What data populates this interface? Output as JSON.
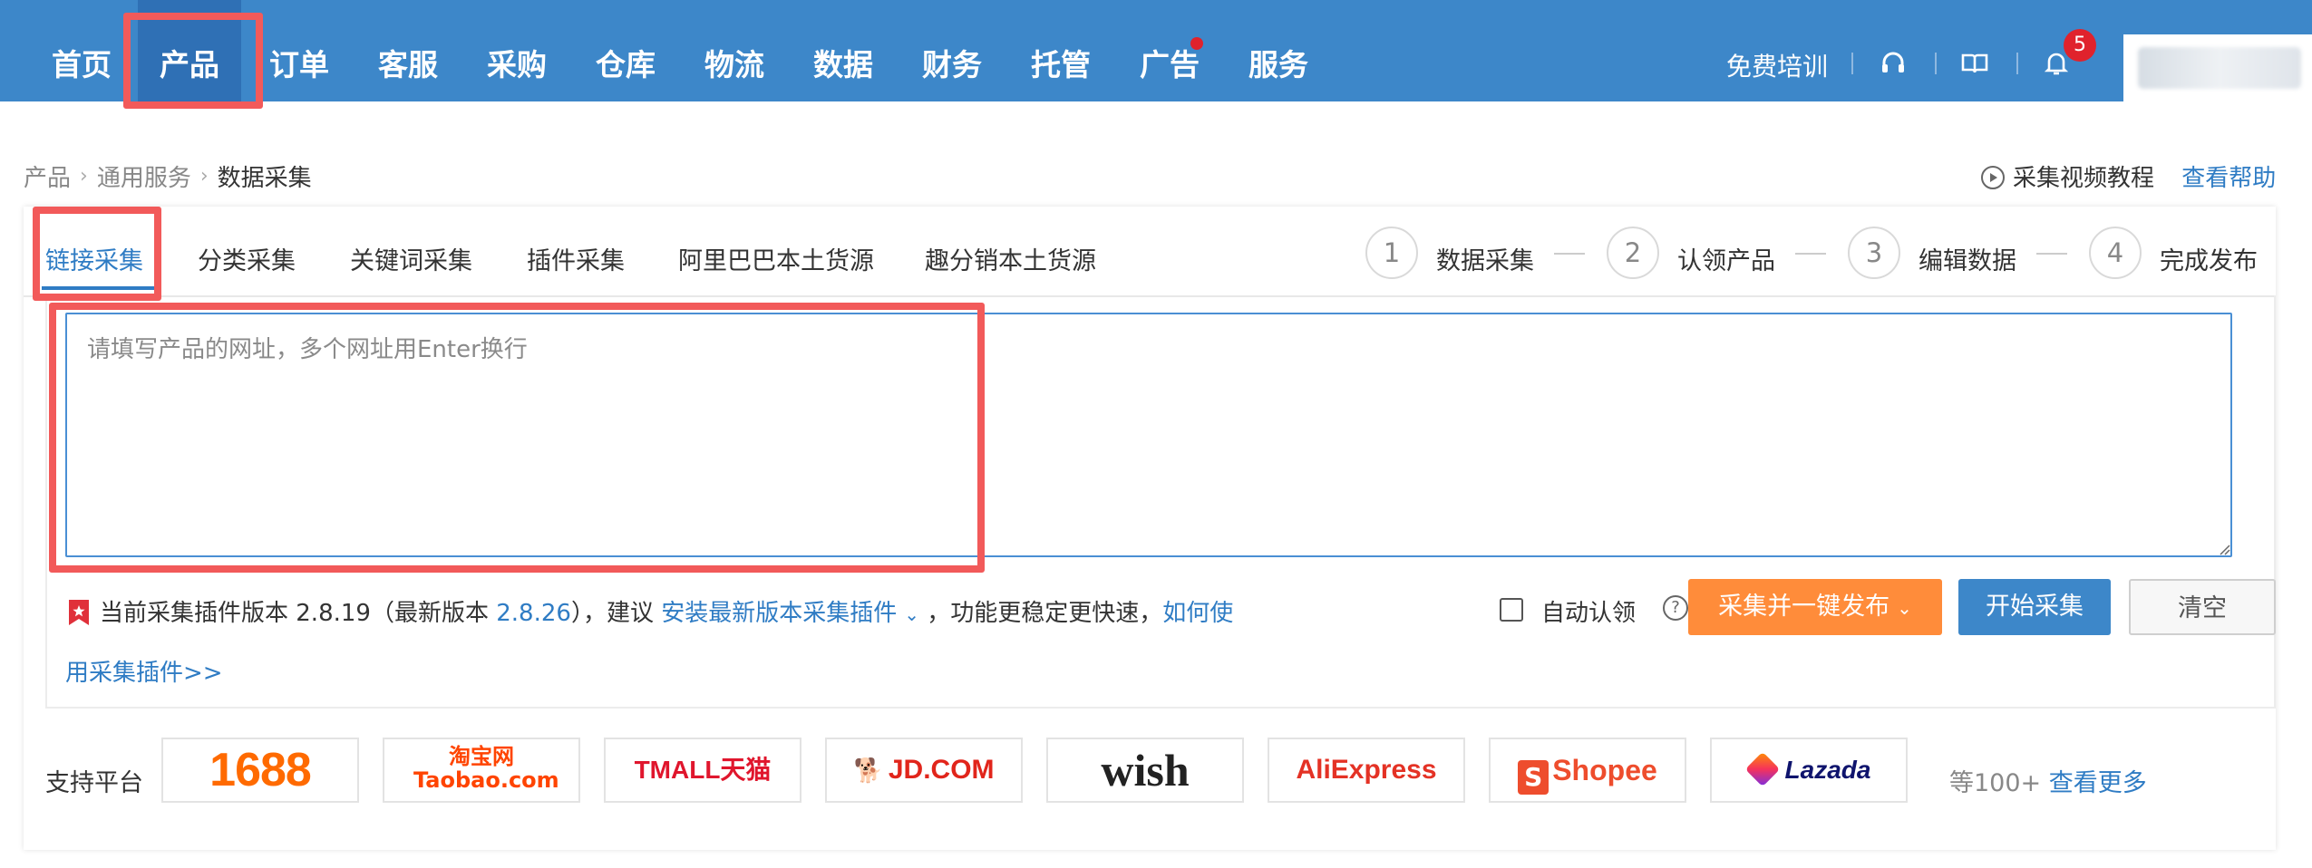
{
  "nav": {
    "items": [
      {
        "label": "首页"
      },
      {
        "label": "产品"
      },
      {
        "label": "订单"
      },
      {
        "label": "客服"
      },
      {
        "label": "采购"
      },
      {
        "label": "仓库"
      },
      {
        "label": "物流"
      },
      {
        "label": "数据"
      },
      {
        "label": "财务"
      },
      {
        "label": "托管"
      },
      {
        "label": "广告"
      },
      {
        "label": "服务"
      }
    ],
    "active_item": "产品",
    "training_label": "免费培训",
    "notification_count": "5",
    "icons": [
      "headset-icon",
      "book-icon",
      "bell-icon"
    ]
  },
  "breadcrumb": {
    "items": [
      "产品",
      "通用服务",
      "数据采集"
    ]
  },
  "help": {
    "video_tutorial": "采集视频教程",
    "view_help": "查看帮助"
  },
  "tabs": [
    {
      "label": "链接采集",
      "active": true
    },
    {
      "label": "分类采集"
    },
    {
      "label": "关键词采集"
    },
    {
      "label": "插件采集"
    },
    {
      "label": "阿里巴巴本土货源"
    },
    {
      "label": "趣分销本土货源"
    }
  ],
  "steps": [
    {
      "num": "1",
      "label": "数据采集"
    },
    {
      "num": "2",
      "label": "认领产品"
    },
    {
      "num": "3",
      "label": "编辑数据"
    },
    {
      "num": "4",
      "label": "完成发布"
    }
  ],
  "url_input": {
    "placeholder": "请填写产品的网址，多个网址用Enter换行",
    "value": ""
  },
  "plugin_notice": {
    "prefix": "当前采集插件版本 2.8.19（最新版本 ",
    "latest_version": "2.8.26",
    "middle": "），建议 ",
    "install_link": "安装最新版本采集插件",
    "suffix": " ，功能更稳定更快速，",
    "howto_link_part1": "如何使",
    "howto_link_part2": "用采集插件>>"
  },
  "controls": {
    "auto_claim_label": "自动认领",
    "auto_claim_checked": false,
    "collect_publish_button": "采集并一键发布",
    "start_button": "开始采集",
    "clear_button": "清空"
  },
  "platforms": {
    "label": "支持平台",
    "logos": [
      "1688",
      "淘宝网 Taobao.com",
      "TMALL天猫",
      "JD.COM",
      "wish",
      "AliExpress",
      "Shopee",
      "Lazada"
    ],
    "more_count": "等100+",
    "more_link": "查看更多"
  },
  "colors": {
    "topbar": "#3d87c9",
    "accent_blue": "#2f7cc4",
    "orange": "#ff8c3a",
    "highlight_red": "#f25a5a"
  }
}
